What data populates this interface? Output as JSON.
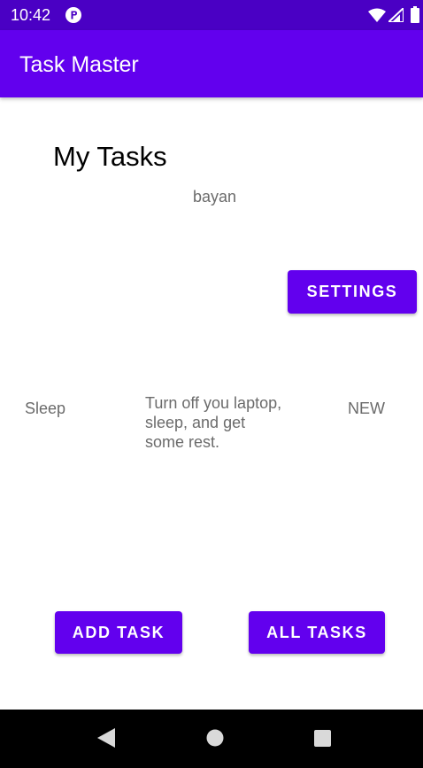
{
  "status_bar": {
    "time": "10:42",
    "icons": [
      "app-notification-icon",
      "wifi-icon",
      "cell-signal-icon",
      "battery-icon"
    ]
  },
  "app_bar": {
    "title": "Task Master"
  },
  "main": {
    "heading": "My Tasks",
    "username": "bayan",
    "settings_label": "SETTINGS"
  },
  "task": {
    "title": "Sleep",
    "body": "Turn off you laptop, sleep, and get some rest.",
    "state": "NEW"
  },
  "actions": {
    "add_task_label": "ADD TASK",
    "all_tasks_label": "ALL TASKS"
  },
  "nav": {
    "icons": [
      "back-icon",
      "home-icon",
      "recents-icon"
    ]
  },
  "colors": {
    "status_bar": "#4a00c4",
    "primary": "#6200ee",
    "secondary_text": "#6b6b6b",
    "nav_bar": "#000000"
  }
}
